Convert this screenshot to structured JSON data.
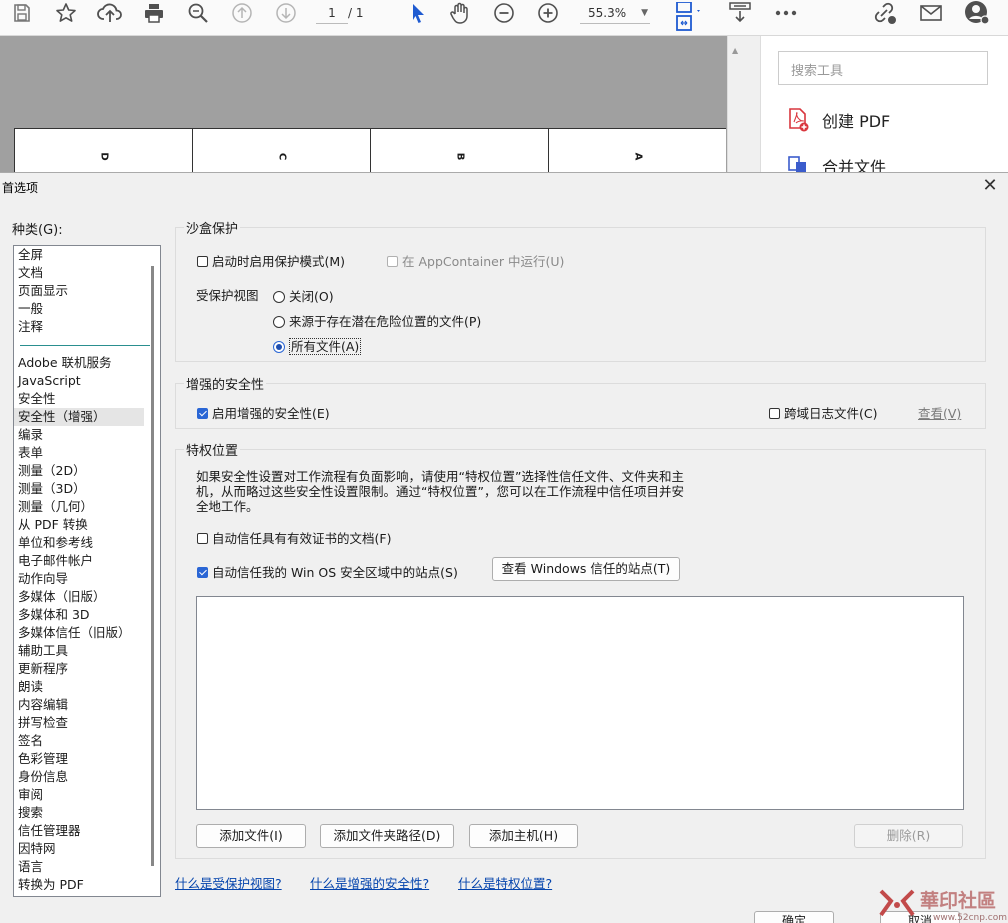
{
  "toolbar": {
    "page_current": "1",
    "page_total": "/ 1",
    "zoom": "55.3%",
    "icons": [
      "save-icon",
      "star-icon",
      "upload-icon",
      "print-icon",
      "zoom-search-icon",
      "arrow-up-icon",
      "arrow-down-icon",
      "select-pointer-icon",
      "hand-icon",
      "zoom-out-icon",
      "zoom-in-icon",
      "fit-page-icon",
      "scroll-mode-icon",
      "more-icon",
      "link-icon",
      "mail-icon",
      "account-icon"
    ]
  },
  "document": {
    "columns": [
      "D",
      "C",
      "B",
      "A"
    ]
  },
  "tools_pane": {
    "search_placeholder": "搜索工具",
    "items": [
      {
        "label": "创建 PDF",
        "icon": "create-pdf-icon",
        "color": "#d9363e"
      },
      {
        "label": "合并文件",
        "icon": "combine-files-icon",
        "color": "#3b5ccc"
      }
    ]
  },
  "dialog": {
    "title": "首选项",
    "category_label": "种类(G):",
    "categories_top": [
      "全屏",
      "文档",
      "页面显示",
      "一般",
      "注释"
    ],
    "categories": [
      "Adobe 联机服务",
      "JavaScript",
      "安全性",
      "安全性（增强）",
      "编录",
      "表单",
      "测量（2D）",
      "测量（3D）",
      "测量（几何）",
      "从 PDF 转换",
      "单位和参考线",
      "电子邮件帐户",
      "动作向导",
      "多媒体（旧版）",
      "多媒体和 3D",
      "多媒体信任（旧版）",
      "辅助工具",
      "更新程序",
      "朗读",
      "内容编辑",
      "拼写检查",
      "签名",
      "色彩管理",
      "身份信息",
      "审阅",
      "搜索",
      "信任管理器",
      "因特网",
      "语言",
      "转换为 PDF"
    ],
    "selected_category": "安全性（增强）",
    "sandbox": {
      "title": "沙盒保护",
      "protected_mode_label": "启动时启用保护模式(M)",
      "protected_mode_checked": false,
      "appcontainer_label": "在 AppContainer 中运行(U)",
      "appcontainer_enabled": false,
      "protected_view_label": "受保护视图",
      "radio_off": "关闭(O)",
      "radio_unsafe": "来源于存在潜在危险位置的文件(P)",
      "radio_all": "所有文件(A)",
      "selected_radio": "所有文件(A)"
    },
    "enhanced": {
      "title": "增强的安全性",
      "enable_label": "启用增强的安全性(E)",
      "enable_checked": true,
      "crossdomain_label": "跨域日志文件(C)",
      "crossdomain_checked": false,
      "view_link": "查看(V)"
    },
    "privileged": {
      "title": "特权位置",
      "description": "如果安全性设置对工作流程有负面影响，请使用“特权位置”选择性信任文件、文件夹和主机，从而略过这些安全性设置限制。通过“特权位置”，您可以在工作流程中信任项目并安全地工作。",
      "trust_cert_label": "自动信任具有有效证书的文档(F)",
      "trust_cert_checked": false,
      "trust_os_label": "自动信任我的 Win OS 安全区域中的站点(S)",
      "trust_os_checked": true,
      "view_windows_button": "查看 Windows 信任的站点(T)",
      "add_file_button": "添加文件(I)",
      "add_folder_button": "添加文件夹路径(D)",
      "add_host_button": "添加主机(H)",
      "delete_button": "删除(R)"
    },
    "help_links": [
      "什么是受保护视图?",
      "什么是增强的安全性?",
      "什么是特权位置?"
    ],
    "ok_button": "确定",
    "cancel_button": "取消"
  },
  "watermark": {
    "text": "華印社區",
    "sub": "www.52cnp.com"
  }
}
